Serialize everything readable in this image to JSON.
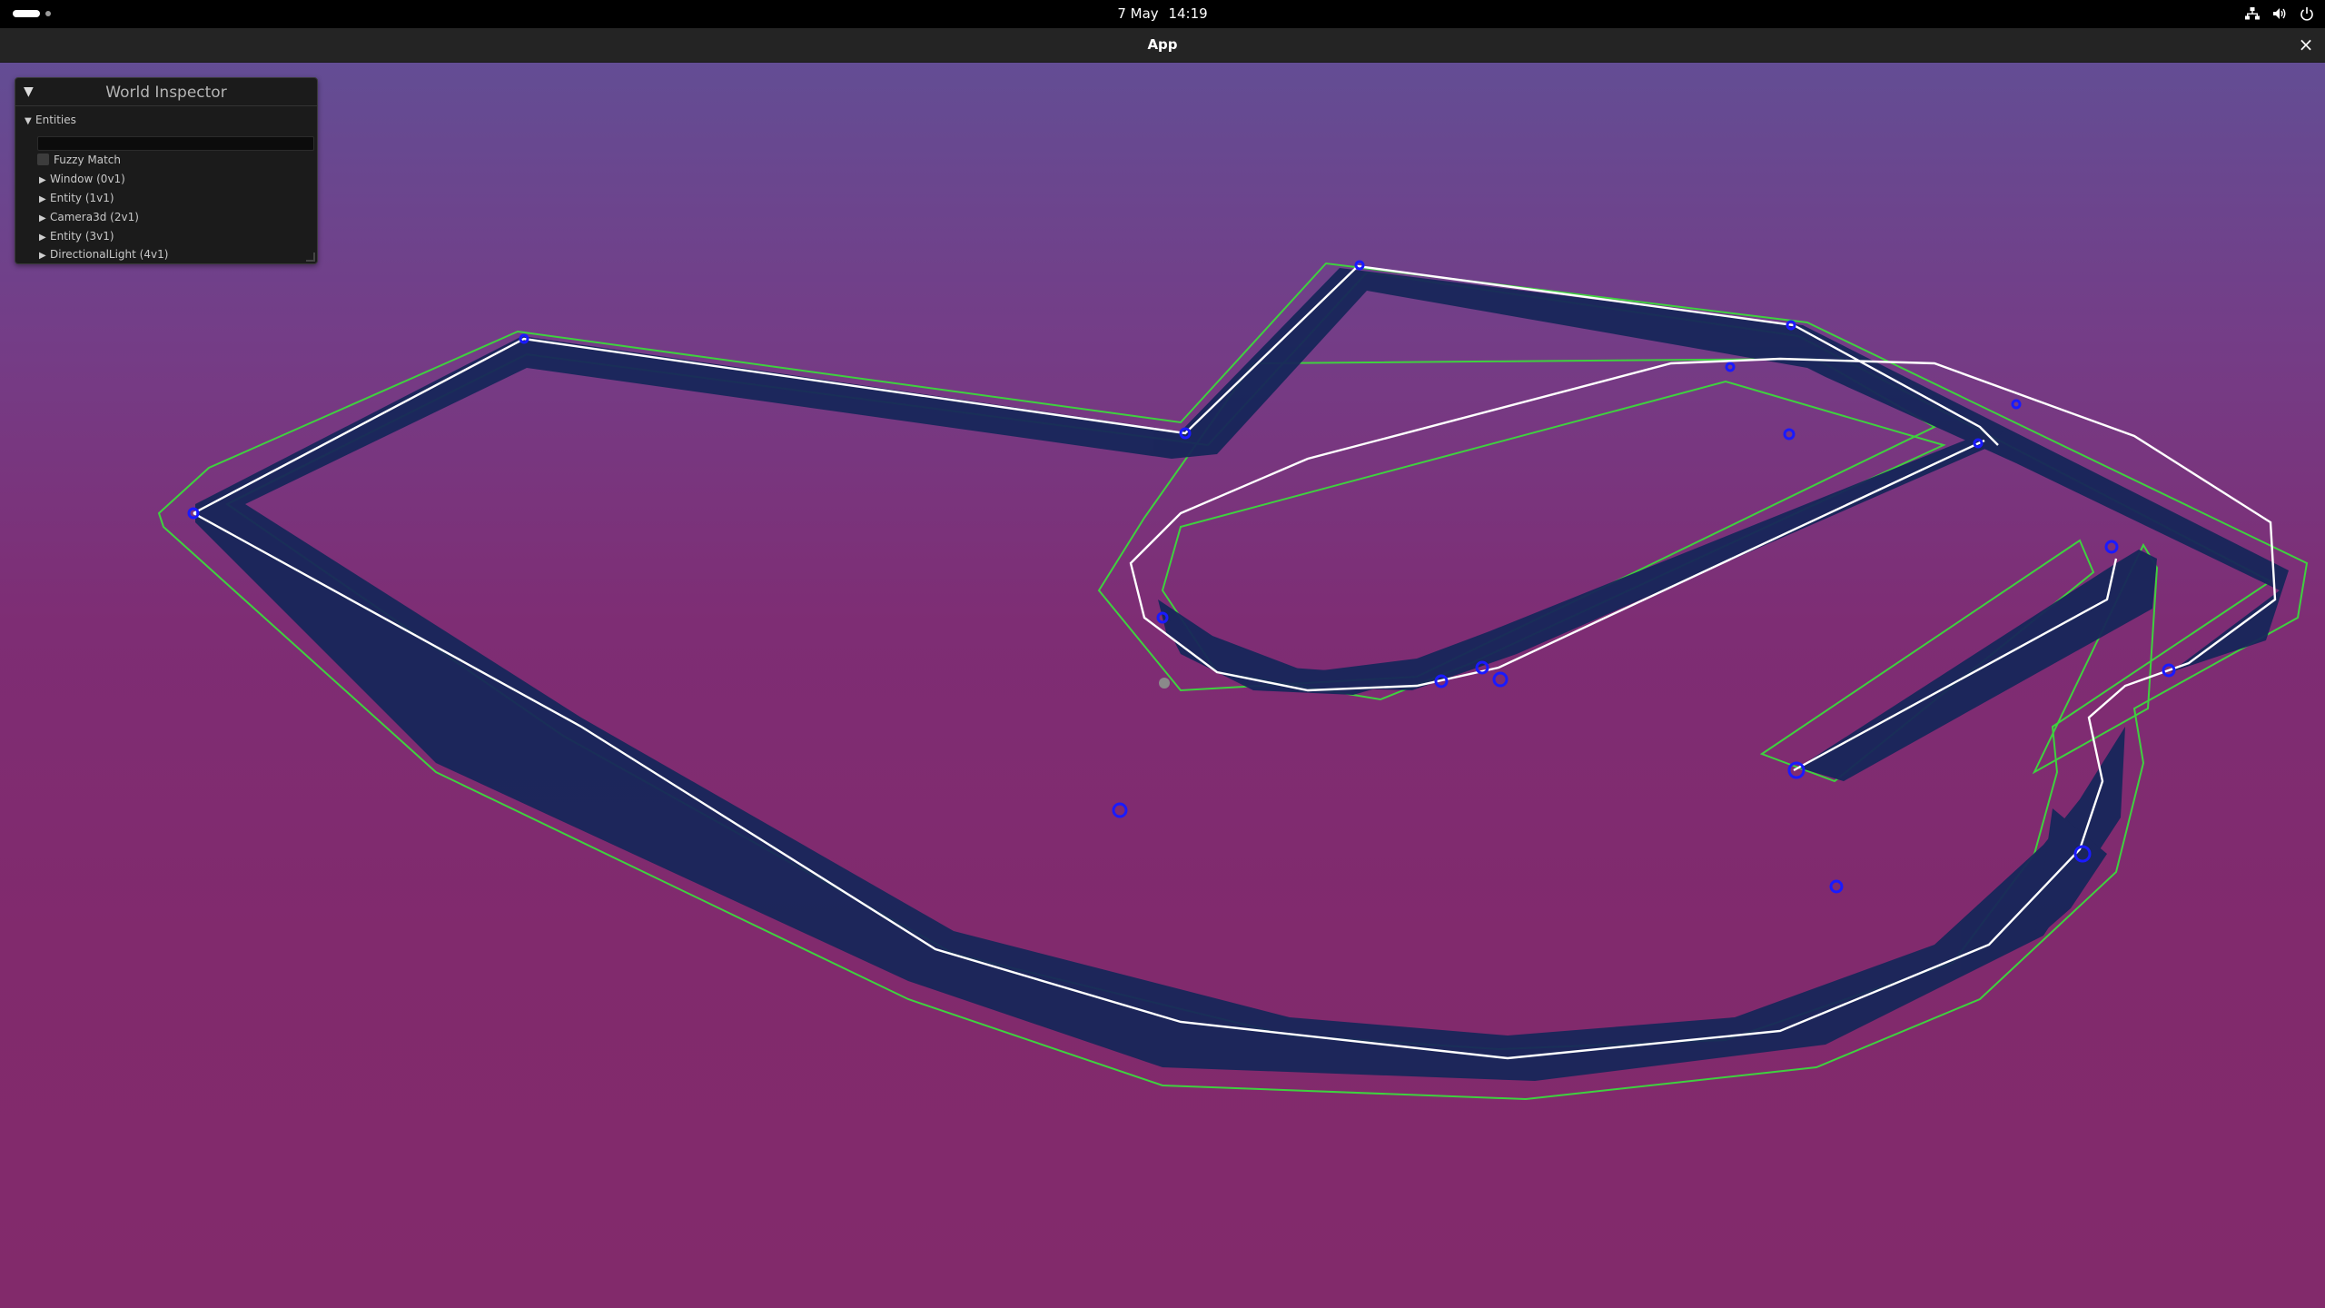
{
  "topbar": {
    "clock_date": "7 May",
    "clock_time": "14:19",
    "tray_icons": [
      "network-icon",
      "volume-icon",
      "power-icon"
    ]
  },
  "window": {
    "title": "App",
    "close_glyph": "×"
  },
  "inspector": {
    "title": "World Inspector",
    "collapse_glyph": "▼",
    "section_label": "Entities",
    "filter_value": "",
    "fuzzy_match_label": "Fuzzy Match",
    "fuzzy_match_checked": false,
    "entities": [
      {
        "label": "Window (0v1)"
      },
      {
        "label": "Entity (1v1)"
      },
      {
        "label": "Camera3d (2v1)"
      },
      {
        "label": "Entity (3v1)"
      },
      {
        "label": "DirectionalLight (4v1)"
      }
    ]
  },
  "scene": {
    "background_top": "#634d94",
    "background_bottom": "#822a6b",
    "road_color": "#17265a",
    "border_color": "#3fd13f",
    "centerline_color": "#ffffff",
    "marker_color": "#1a1aff"
  }
}
